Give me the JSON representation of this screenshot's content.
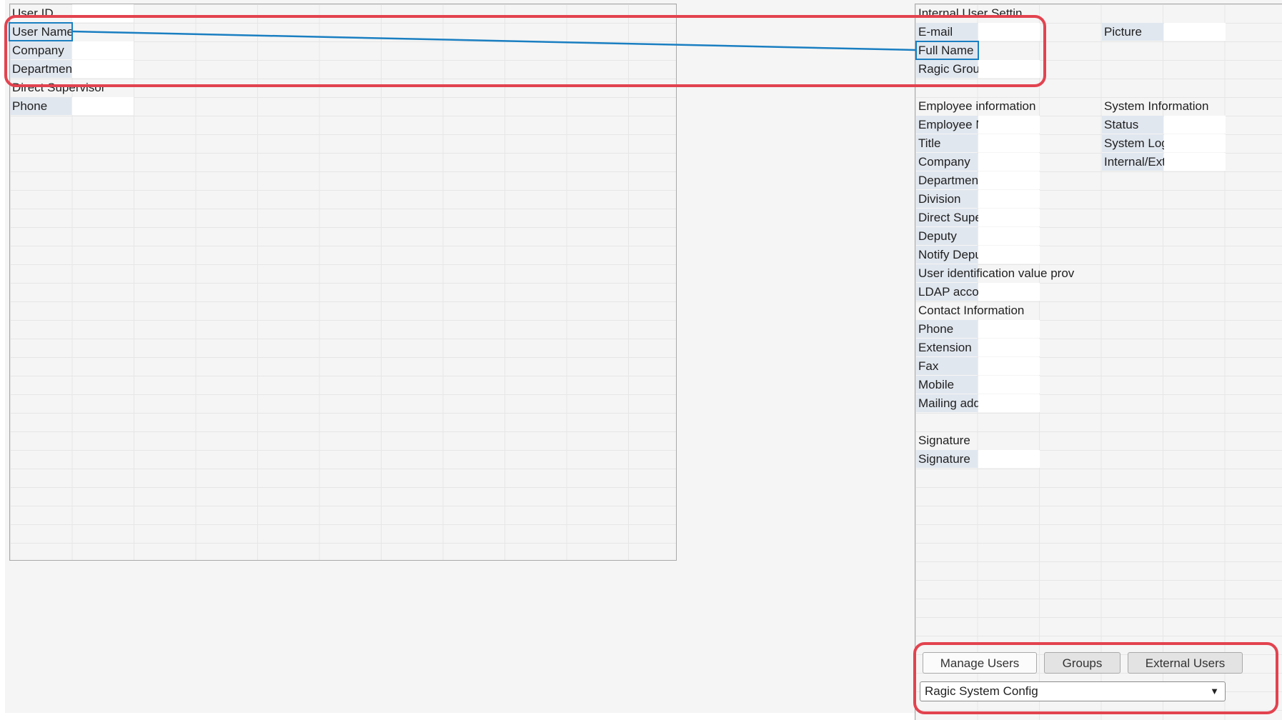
{
  "left_form": {
    "fields": [
      {
        "label": "User ID"
      },
      {
        "label": "User Name"
      },
      {
        "label": "Company"
      },
      {
        "label": "Department"
      },
      {
        "label": "Direct Supervisor"
      },
      {
        "label": "Phone"
      }
    ]
  },
  "right_form": {
    "section_title": "Internal User Settin",
    "email_label": "E-mail",
    "picture_label": "Picture",
    "full_name_label": "Full Name",
    "groups_label": "Ragic Groups",
    "employee_section": "Employee information",
    "system_section": "System Information",
    "employee_fields": [
      "Employee Number",
      "Title",
      "Company",
      "Department",
      "Division",
      "Direct Supervisor",
      "Deputy",
      "Notify Deputy",
      "User identification value prov",
      "LDAP account",
      "Contact Information",
      "Phone",
      "Extension",
      "Fax",
      "Mobile",
      "Mailing address"
    ],
    "system_fields": [
      "Status",
      "System Log",
      "Internal/External"
    ],
    "signature_section": "Signature",
    "signature_field": "Signature"
  },
  "tabs": [
    {
      "label": "Manage Users"
    },
    {
      "label": "Groups"
    },
    {
      "label": "External Users"
    }
  ],
  "config_select": {
    "value": "Ragic System Config"
  },
  "colors": {
    "highlight": "#e2434f",
    "selection": "#1a7fc1",
    "label_bg": "#e1e7ef"
  }
}
